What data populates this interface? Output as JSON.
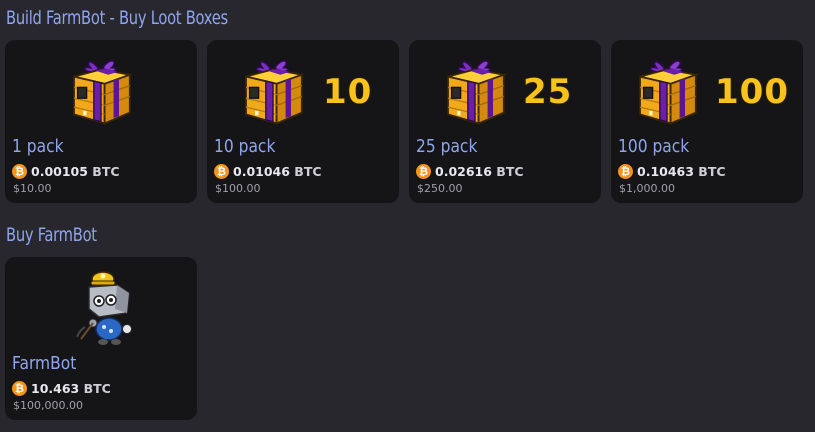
{
  "sections": {
    "loot_title": "Build FarmBot - Buy Loot Boxes",
    "farmbot_title": "Buy FarmBot"
  },
  "loot_boxes": [
    {
      "name": "1 pack",
      "badge": "",
      "btc": "0.00105",
      "unit": "BTC",
      "usd": "$10.00"
    },
    {
      "name": "10 pack",
      "badge": "10",
      "btc": "0.01046",
      "unit": "BTC",
      "usd": "$100.00"
    },
    {
      "name": "25 pack",
      "badge": "25",
      "btc": "0.02616",
      "unit": "BTC",
      "usd": "$250.00"
    },
    {
      "name": "100 pack",
      "badge": "100",
      "btc": "0.10463",
      "unit": "BTC",
      "usd": "$1,000.00"
    }
  ],
  "farmbot": {
    "name": "FarmBot",
    "btc": "10.463",
    "unit": "BTC",
    "usd": "$100,000.00"
  },
  "icons": {
    "currency": "bitcoin-icon",
    "loot": "loot-box-icon",
    "robot": "farmbot-robot-icon"
  },
  "colors": {
    "background": "#28272d",
    "card": "#151517",
    "title": "#8ea6ee",
    "bitcoin": "#f7931a",
    "box_gold": "#f1a81a",
    "box_ribbon": "#6b1fa8"
  }
}
